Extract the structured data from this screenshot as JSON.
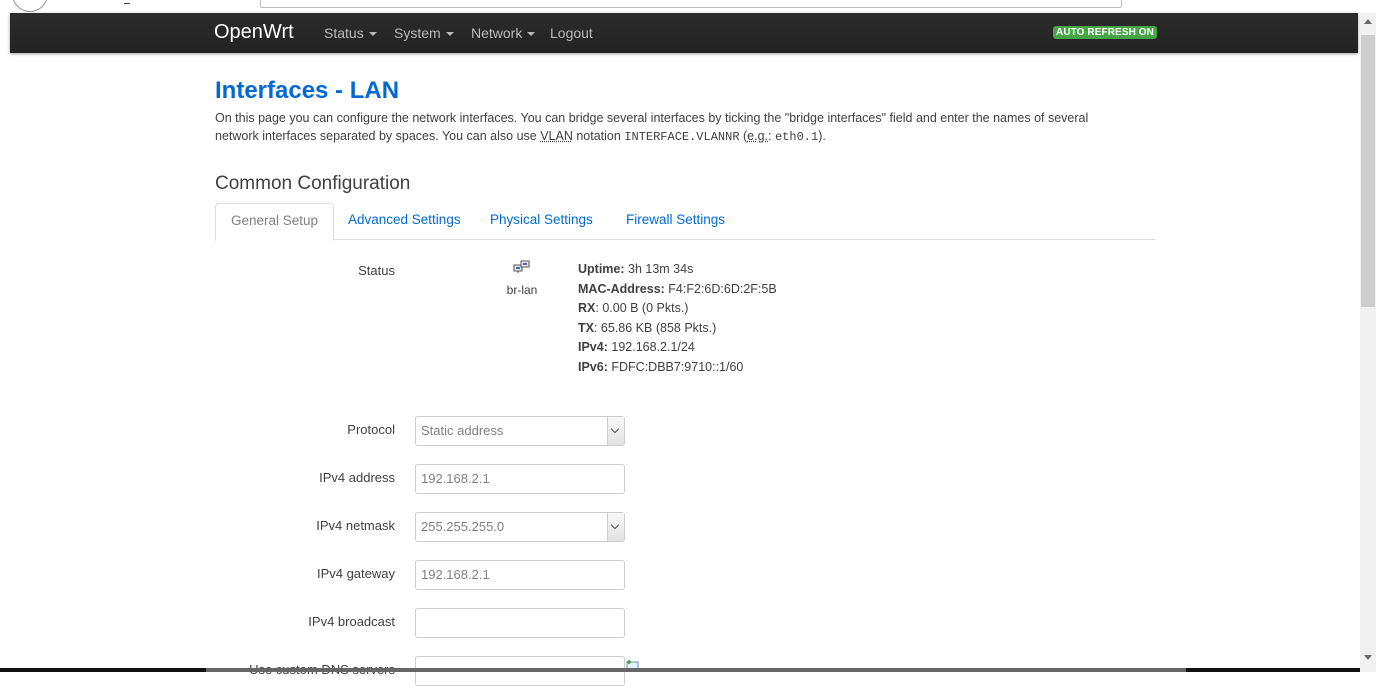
{
  "navbar": {
    "brand": "OpenWrt",
    "menu": [
      {
        "label": "Status",
        "has_caret": true
      },
      {
        "label": "System",
        "has_caret": true
      },
      {
        "label": "Network",
        "has_caret": true
      },
      {
        "label": "Logout",
        "has_caret": false
      }
    ],
    "auto_refresh_badge": "AUTO REFRESH ON",
    "badge_color": "#46a546",
    "background_color": "#222222"
  },
  "page": {
    "title": "Interfaces - LAN",
    "intro_part1": "On this page you can configure the network interfaces. You can bridge several interfaces by ticking the \"bridge interfaces\" field and enter the names of several network interfaces separated by spaces. You can also use ",
    "intro_vlan_abbr": "VLAN",
    "intro_part2": " notation ",
    "intro_code1": "INTERFACE.VLANNR",
    "intro_part3": " (",
    "intro_eg_abbr": "e.g.",
    "intro_part4": ": ",
    "intro_code2": "eth0.1",
    "intro_part5": ").",
    "accent_color": "#0069d6"
  },
  "section": {
    "title": "Common Configuration",
    "tabs": [
      {
        "label": "General Setup",
        "active": true
      },
      {
        "label": "Advanced Settings",
        "active": false
      },
      {
        "label": "Physical Settings",
        "active": false
      },
      {
        "label": "Firewall Settings",
        "active": false
      }
    ]
  },
  "status": {
    "label": "Status",
    "interface_icon": "network-device-icon",
    "interface_name": "br-lan",
    "rows": [
      {
        "key": "Uptime:",
        "value": "3h 13m 34s"
      },
      {
        "key": "MAC-Address:",
        "value": "F4:F2:6D:6D:2F:5B"
      },
      {
        "key": "RX",
        "value": ": 0.00 B (0 Pkts.)"
      },
      {
        "key": "TX",
        "value": ": 65.86 KB (858 Pkts.)"
      },
      {
        "key": "IPv4:",
        "value": "192.168.2.1/24"
      },
      {
        "key": "IPv6:",
        "value": "FDFC:DBB7:9710::1/60"
      }
    ]
  },
  "form": {
    "protocol": {
      "label": "Protocol",
      "value": "Static address"
    },
    "ipv4_address": {
      "label": "IPv4 address",
      "value": "192.168.2.1"
    },
    "ipv4_netmask": {
      "label": "IPv4 netmask",
      "value": "255.255.255.0"
    },
    "ipv4_gateway": {
      "label": "IPv4 gateway",
      "value": "192.168.2.1"
    },
    "ipv4_broadcast": {
      "label": "IPv4 broadcast",
      "value": ""
    },
    "custom_dns": {
      "label": "Use custom DNS servers",
      "value": ""
    }
  }
}
